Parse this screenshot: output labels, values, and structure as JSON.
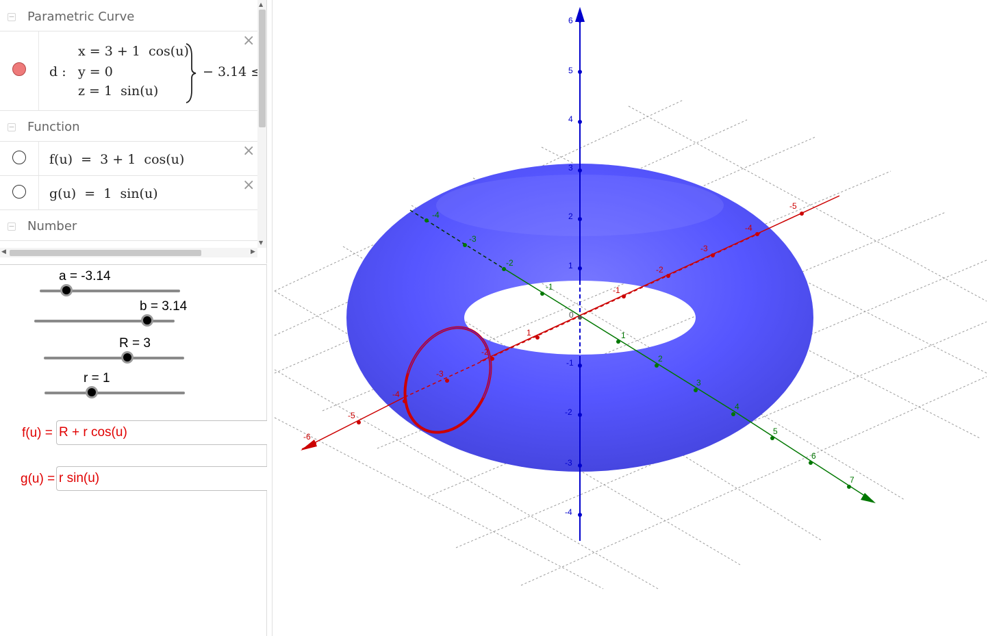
{
  "algebra": {
    "categories": {
      "parametric_curve": "Parametric Curve",
      "function": "Function",
      "number": "Number"
    },
    "curve_d": {
      "name": "d :",
      "x_eq": "x = 3 + 1  cos(u)",
      "y_eq": "y = 0",
      "z_eq": "z = 1  sin(u)",
      "range": "− 3.14 ≤"
    },
    "func_f": "f(u)  =  3 + 1  cos(u)",
    "func_g": "g(u)  =  1  sin(u)",
    "close_glyph": "×",
    "collapse_glyph": "−"
  },
  "sliders": [
    {
      "label": "a = -3.14",
      "value": -3.14,
      "min": -3.14,
      "max": 3.14
    },
    {
      "label": "b = 3.14",
      "value": 3.14,
      "min": -3.14,
      "max": 3.14
    },
    {
      "label": "R = 3",
      "value": 3,
      "min": 0,
      "max": 5
    },
    {
      "label": "r = 1",
      "value": 1,
      "min": 0,
      "max": 5
    }
  ],
  "inputs": {
    "f_label": "f(u) =",
    "f_value": "R + r cos(u)",
    "g_label": "g(u) =",
    "g_value": "r sin(u)"
  },
  "view3d": {
    "torus_color": "#5a5aff",
    "curve_color": "#cc0000",
    "axis_x_color": "#cc0000",
    "axis_y_color": "#007700",
    "axis_z_color": "#0000cc",
    "origin_label": "0",
    "x_ticks": [
      "-6",
      "-5",
      "-4",
      "-3",
      "-2",
      "1",
      "-1",
      "-2",
      "-3",
      "-4",
      "-5"
    ],
    "y_ticks": [
      "-4",
      "-3",
      "-2",
      "-1",
      "1",
      "2",
      "3",
      "4",
      "5",
      "6",
      "7"
    ],
    "z_ticks": [
      "6",
      "5",
      "4",
      "3",
      "2",
      "1",
      "-1",
      "-2",
      "-3",
      "-4"
    ]
  }
}
